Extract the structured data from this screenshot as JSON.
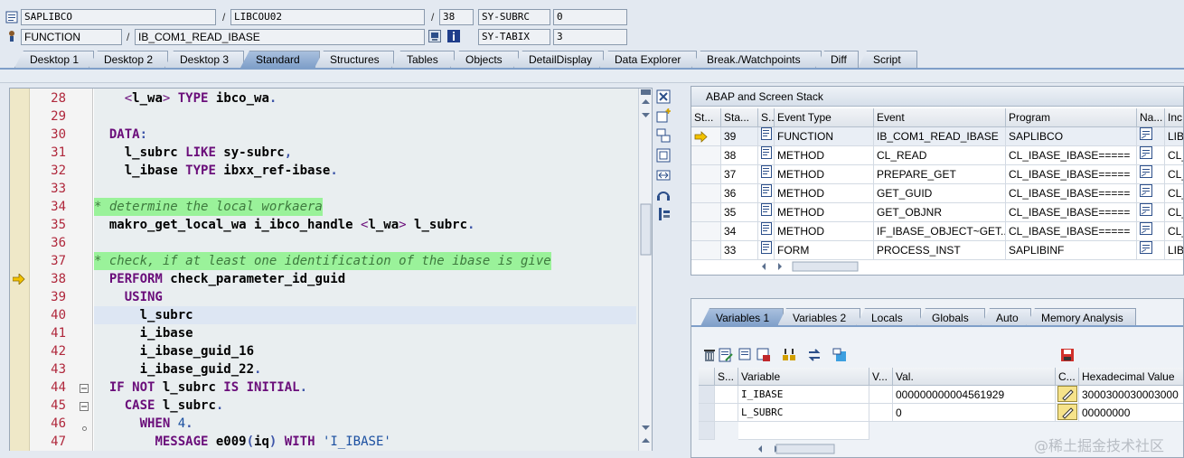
{
  "header": {
    "program": "SAPLIBCO",
    "include": "LIBCOU02",
    "line": "38",
    "var1_name": "SY-SUBRC",
    "var1_value": "0",
    "type": "FUNCTION",
    "name": "IB_COM1_READ_IBASE",
    "var2_name": "SY-TABIX",
    "var2_value": "3",
    "slash": "/"
  },
  "tabs": [
    "Desktop 1",
    "Desktop 2",
    "Desktop 3",
    "Standard",
    "Structures",
    "Tables",
    "Objects",
    "DetailDisplay",
    "Data Explorer",
    "Break./Watchpoints",
    "Diff",
    "Script"
  ],
  "active_tab": "Standard",
  "code": [
    {
      "n": "28",
      "t": "    <l_wa> TYPE ibco_wa."
    },
    {
      "n": "29",
      "t": ""
    },
    {
      "n": "30",
      "t": "  DATA:"
    },
    {
      "n": "31",
      "t": "    l_subrc LIKE sy-subrc,"
    },
    {
      "n": "32",
      "t": "    l_ibase TYPE ibxx_ref-ibase."
    },
    {
      "n": "33",
      "t": ""
    },
    {
      "n": "34",
      "t": "* determine the local workaera"
    },
    {
      "n": "35",
      "t": "  makro_get_local_wa i_ibco_handle <l_wa> l_subrc."
    },
    {
      "n": "36",
      "t": ""
    },
    {
      "n": "37",
      "t": "* check, if at least one identification of the ibase is give"
    },
    {
      "n": "38",
      "t": "  PERFORM check_parameter_id_guid"
    },
    {
      "n": "39",
      "t": "    USING"
    },
    {
      "n": "40",
      "t": "      l_subrc"
    },
    {
      "n": "41",
      "t": "      i_ibase"
    },
    {
      "n": "42",
      "t": "      i_ibase_guid_16"
    },
    {
      "n": "43",
      "t": "      i_ibase_guid_22."
    },
    {
      "n": "44",
      "t": "  IF NOT l_subrc IS INITIAL."
    },
    {
      "n": "45",
      "t": "    CASE l_subrc."
    },
    {
      "n": "46",
      "t": "      WHEN 4."
    },
    {
      "n": "47",
      "t": "        MESSAGE e009(iq) WITH 'I_IBASE'"
    }
  ],
  "stack": {
    "title": "ABAP and Screen Stack",
    "headers": [
      "St...",
      "Sta...",
      "S...",
      "Event Type",
      "Event",
      "Program",
      "Na...",
      "Inc"
    ],
    "rows": [
      {
        "level": "39",
        "type": "FUNCTION",
        "event": "IB_COM1_READ_IBASE",
        "program": "SAPLIBCO",
        "inc": "LIBC",
        "current": true
      },
      {
        "level": "38",
        "type": "METHOD",
        "event": "CL_READ",
        "program": "CL_IBASE_IBASE=====",
        "inc": "CL_"
      },
      {
        "level": "37",
        "type": "METHOD",
        "event": "PREPARE_GET",
        "program": "CL_IBASE_IBASE=====",
        "inc": "CL_"
      },
      {
        "level": "36",
        "type": "METHOD",
        "event": "GET_GUID",
        "program": "CL_IBASE_IBASE=====",
        "inc": "CL_"
      },
      {
        "level": "35",
        "type": "METHOD",
        "event": "GET_OBJNR",
        "program": "CL_IBASE_IBASE=====",
        "inc": "CL_"
      },
      {
        "level": "34",
        "type": "METHOD",
        "event": "IF_IBASE_OBJECT~GET...",
        "program": "CL_IBASE_IBASE=====",
        "inc": "CL_"
      },
      {
        "level": "33",
        "type": "FORM",
        "event": "PROCESS_INST",
        "program": "SAPLIBINF",
        "inc": "LIBI"
      }
    ]
  },
  "vars": {
    "tabs": [
      "Variables 1",
      "Variables 2",
      "Locals",
      "Globals",
      "Auto",
      "Memory Analysis"
    ],
    "headers": [
      "S...",
      "Variable",
      "V...",
      "Val.",
      "C...",
      "Hexadecimal Value"
    ],
    "rows": [
      {
        "name": "I_IBASE",
        "value": "000000000004561929",
        "hex": "3000300030003000"
      },
      {
        "name": "L_SUBRC",
        "value": "0",
        "hex": "00000000"
      }
    ]
  },
  "watermark": "@稀土掘金技术社区",
  "colors": {
    "accent": "#7f9fc9",
    "keyword": "#6a0d7a",
    "comment_bg": "#9af29a",
    "line_number": "#b0283c"
  }
}
